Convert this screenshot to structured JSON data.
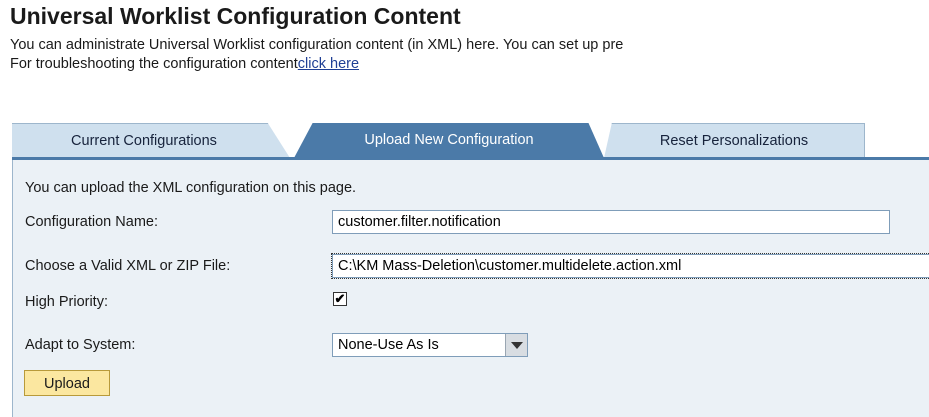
{
  "header": {
    "title": "Universal Worklist Configuration Content",
    "description": "You can administrate Universal Worklist configuration content (in XML) here. You can set up pre",
    "troubleshoot_text": "For troubleshooting the configuration content",
    "troubleshoot_link": "click here"
  },
  "tabs": [
    {
      "label": "Current Configurations",
      "selected": false
    },
    {
      "label": "Upload New Configuration",
      "selected": true
    },
    {
      "label": "Reset Personalizations",
      "selected": false
    }
  ],
  "form": {
    "intro": "You can upload the XML configuration on this page.",
    "config_name_label": "Configuration Name:",
    "config_name_value": "customer.filter.notification",
    "file_label": "Choose a Valid XML or ZIP File:",
    "file_value": "C:\\KM Mass-Deletion\\customer.multidelete.action.xml",
    "priority_label": "High Priority:",
    "priority_checked": true,
    "checkmark": "✔",
    "adapt_label": "Adapt to System:",
    "adapt_value": "None-Use As Is",
    "upload_label": "Upload"
  },
  "colors": {
    "active_tab": "#4b7aa8",
    "inactive_tab": "#cfe0ee",
    "panel": "#ebf1f6",
    "button": "#fbe7a0",
    "link": "#1f3f95"
  }
}
